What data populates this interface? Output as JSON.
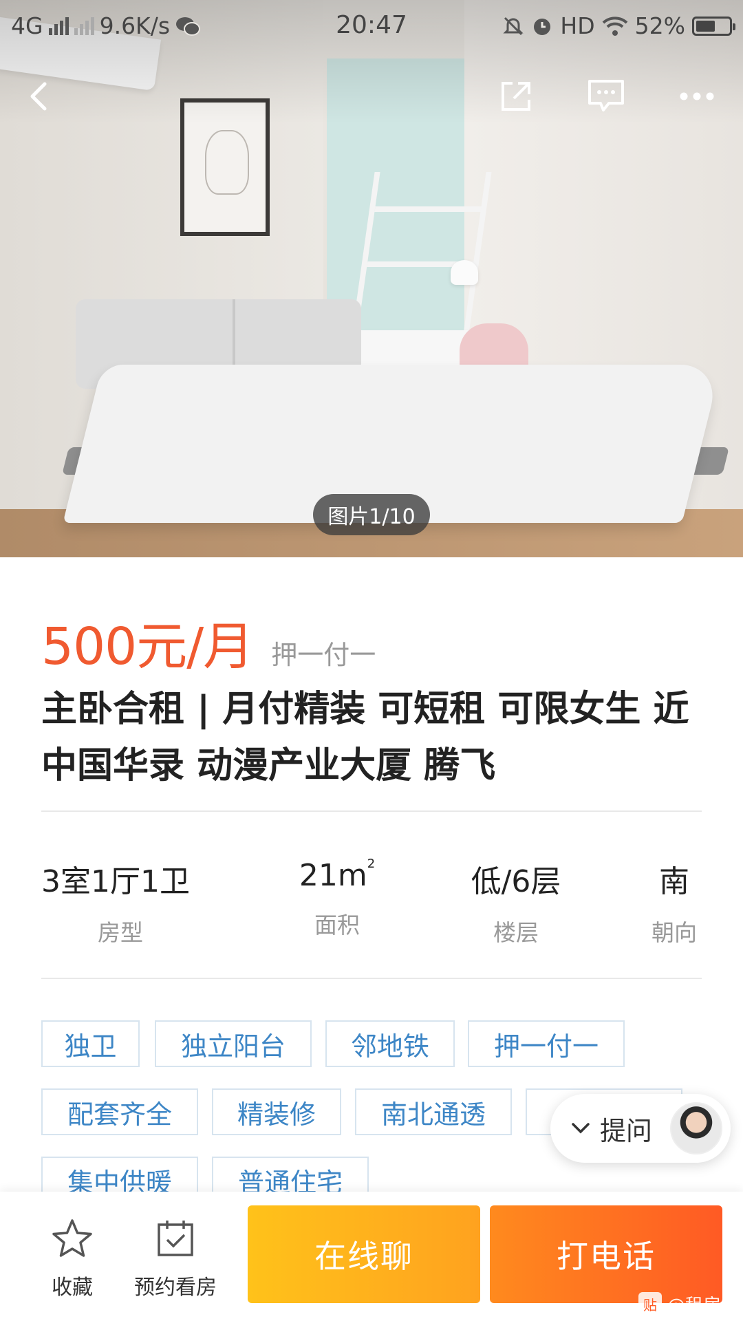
{
  "status_bar": {
    "network": "4G",
    "speed": "9.6K/s",
    "time": "20:47",
    "hd": "HD",
    "battery": "52%"
  },
  "gallery": {
    "counter": "图片1/10"
  },
  "listing": {
    "price": "500元/月",
    "payment_term": "押一付一",
    "title": "主卧合租 | 月付精装 可短租 可限女生 近中国华录 动漫产业大厦 腾飞"
  },
  "facts": [
    {
      "value": "3室1厅1卫",
      "label": "房型"
    },
    {
      "value": "21m",
      "sup": "2",
      "label": "面积"
    },
    {
      "value": "低/6层",
      "label": "楼层"
    },
    {
      "value": "南",
      "label": "朝向"
    }
  ],
  "tags": [
    "独卫",
    "独立阳台",
    "邻地铁",
    "押一付一",
    "配套齐全",
    "精装修",
    "南北通透",
    "",
    "集中供暖",
    "普通住宅"
  ],
  "ask": {
    "label": "提问"
  },
  "bottom_bar": {
    "favorite_label": "收藏",
    "appointment_label": "预约看房",
    "chat_label": "在线聊",
    "call_label": "打电话"
  },
  "watermark": {
    "icon_text": "贴",
    "text": "@租房吧"
  },
  "colors": {
    "price": "#f05a30",
    "tag_text": "#3d86c6",
    "chat_button": "#ffb21c",
    "call_button": "#ff6a22"
  },
  "icons": [
    "back-icon",
    "share-icon",
    "message-icon",
    "more-icon",
    "star-icon",
    "calendar-check-icon",
    "chevron-down-icon"
  ]
}
